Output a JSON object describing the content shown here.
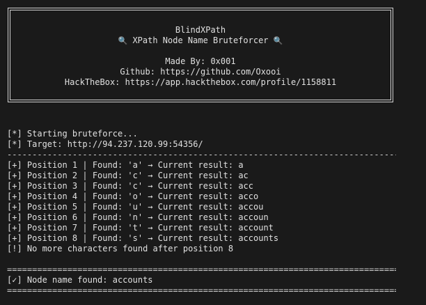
{
  "banner": {
    "title": "BlindXPath",
    "subtitle": "XPath Node Name Bruteforcer",
    "made_by": "Made By: 0x001",
    "github": "Github: https://github.com/Oxooi",
    "htb": "HackTheBox: https://app.hackthebox.com/profile/1158811"
  },
  "icons": {
    "subtitle_left": "magnifier-icon",
    "subtitle_right": "magnifier-icon"
  },
  "log": {
    "start": "[*] Starting bruteforce...",
    "target": "[*] Target: http://94.237.120.99:54356/",
    "positions": [
      "[+] Position 1 | Found: 'a' → Current result: a",
      "[+] Position 2 | Found: 'c' → Current result: ac",
      "[+] Position 3 | Found: 'c' → Current result: acc",
      "[+] Position 4 | Found: 'o' → Current result: acco",
      "[+] Position 5 | Found: 'u' → Current result: accou",
      "[+] Position 6 | Found: 'n' → Current result: accoun",
      "[+] Position 7 | Found: 't' → Current result: account",
      "[+] Position 8 | Found: 's' → Current result: accounts"
    ],
    "no_more": "[!] No more characters found after position 8",
    "result": "[✓] Node name found: accounts"
  },
  "rules": {
    "dash": "--------------------------------------------------------------------------------------------------------",
    "equal": "========================================================================================================"
  },
  "colors": {
    "background": "#1a1a1a",
    "text": "#e0e0e0"
  }
}
